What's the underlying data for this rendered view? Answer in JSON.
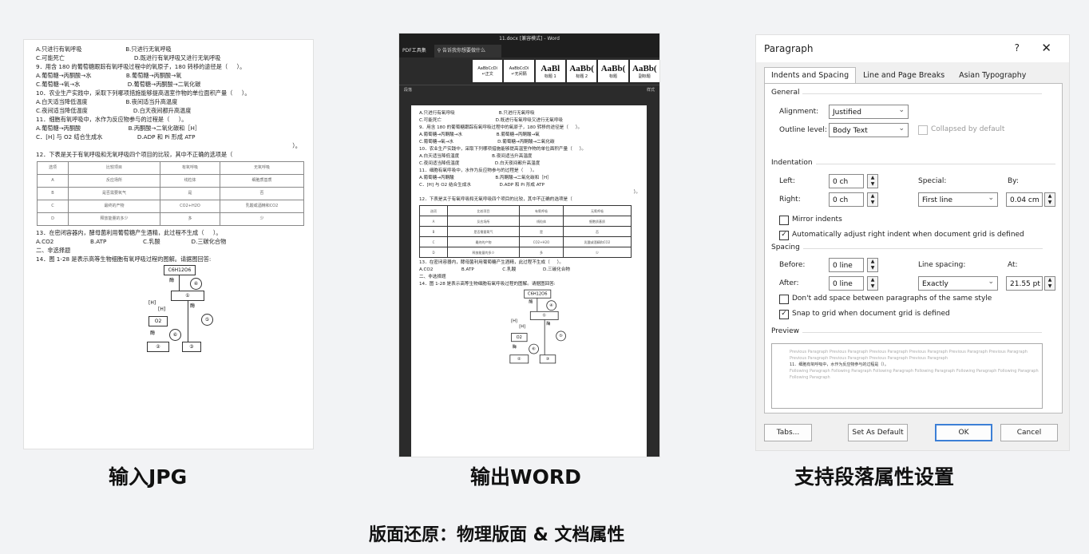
{
  "left_doc": {
    "lines": [
      "A.只进行有氧呼吸                        B.只进行无氧呼吸",
      "C.可能死亡                                      D.既进行有氧呼吸又进行无氧呼吸",
      "9．用含 180 的葡萄糖跟踪有氧呼吸过程中的氧原子，180 转移的途径是（     ）。",
      "A.葡萄糖→丙酮酸→水                   B.葡萄糖→丙酮酸→氧",
      "C.葡萄糖→氧→水                          D.葡萄糖→丙酮酸→二氧化碳",
      "10．农业生产实践中，采取下列哪项措施能够提高温室作物的单位面积产量（     ）。",
      "A.白天适当降低温度                     B.夜间适当升高温度",
      "C.夜间适当降低温度                         D.白天夜间都升高温度",
      "11．细胞有氧呼吸中，水作为反应物参与的过程是（     ）。",
      "A.葡萄糖→丙酮酸                          B.丙酮酸→二氧化碳和［H］",
      "C．[H] 与 O2 结合生成水                   D.ADP 和 Pi 形成 ATP"
    ],
    "trail": "）。",
    "q12": "12．下表是关于有氧呼吸和无氧呼吸四个项目的比较，其中不正确的选项是（",
    "table": [
      [
        "选项",
        "比较项目",
        "有氧呼吸",
        "无氧呼吸"
      ],
      [
        "A",
        "反应场所",
        "线粒体",
        "细胞质基质"
      ],
      [
        "B",
        "是否需要氧气",
        "是",
        "否"
      ],
      [
        "C",
        "最终的产物",
        "CO2+H2O",
        "乳酸或酒精和CO2"
      ],
      [
        "D",
        "释放能量的多少",
        "多",
        "少"
      ]
    ],
    "lines2": [
      "13．在密闭容器内，酵母菌利用葡萄糖产生酒精，此过程不生成（     ）。",
      "A.CO2                    B.ATP                    C.乳酸                 D.三碳化合物",
      "二、非选择题",
      "14．图 1-28 是表示高等生物细胞有氧呼吸过程的图解。请据图回答:"
    ],
    "diagram": {
      "top": "C6H12O6",
      "enzyme": "酶",
      "h1": "[H]",
      "h2": "[H]",
      "o2": "O2",
      "n1": "①",
      "n2": "②",
      "n3": "③",
      "n4": "④",
      "n5": "⑤",
      "n6": "⑥"
    }
  },
  "word": {
    "title": "11.docx [兼容模式] - Word",
    "tab_pdf": "PDF工具集",
    "search": "告诉我你想要做什么",
    "styles": [
      {
        "preview": "AaBbCcDi",
        "name": "↵正文"
      },
      {
        "preview": "AaBbCcDi",
        "name": "↵无间隔"
      },
      {
        "preview": "AaBl",
        "name": "标题 1"
      },
      {
        "preview": "AaBb(",
        "name": "标题 2"
      },
      {
        "preview": "AaBb(",
        "name": "标题"
      },
      {
        "preview": "AaBb(",
        "name": "副标题"
      }
    ],
    "group_para": "段落",
    "group_style": "样式",
    "lines": [
      "A.只进行有氧呼吸                               B.只进行无氧呼吸",
      "C.可能死亡                                      D.既进行有氧呼吸又进行无氧呼吸",
      "9．用含 180 的葡萄糖跟踪有氧呼吸过程中的氧原子，180 转移的途径是（     ）。",
      "A.葡萄糖→丙酮酸→水                        B.葡萄糖→丙酮酸→氧",
      "C.葡萄糖→氧→水                               D.葡萄糖→丙酮酸→二氧化碳",
      "10．农业生产实践中，采取下列哪项措施能够提高温室作物的单位面积产量（     ）。",
      "A.白天适当降低温度                       B.夜间适当升高温度",
      "C.夜间适当降低温度                         D.白天夜间都升高温度",
      "11．细胞有氧呼吸中，水作为反应物参与的过程是（     ）。",
      "A.葡萄糖→丙酮酸                             B.丙酮酸→二氧化碳和［H］",
      "C．[H] 与 O2 结合生成水                    D.ADP 和 Pi 形成 ATP"
    ],
    "trail": "）。",
    "q12": "12．下表是关于有氧呼吸和无氧呼吸四个项目的比较，其中不正确的选项是（",
    "table": [
      [
        "选项",
        "比较项目",
        "有氧呼吸",
        "无氧呼吸"
      ],
      [
        "A",
        "反应场所",
        "线粒体",
        "细胞质基质"
      ],
      [
        "B",
        "是否需要氧气",
        "是",
        "否"
      ],
      [
        "C",
        "最终的产物",
        "CO2+H2O",
        "乳酸或酒精和CO2"
      ],
      [
        "D",
        "释放能量的多少",
        "多",
        "少"
      ]
    ],
    "lines2": [
      "13．在密闭容器内，酵母菌利用葡萄糖产生酒精，此过程不生成（     ）。",
      "A.CO2                    B.ATP                    C.乳酸                   D.三碳化合物",
      "二、非选择题",
      "14．图 1-28 是表示高等生物细胞有氧呼吸过程的图解。请据图回答:"
    ]
  },
  "dialog": {
    "title": "Paragraph",
    "help": "?",
    "close": "✕",
    "tabs": [
      "Indents and Spacing",
      "Line and Page Breaks",
      "Asian Typography"
    ],
    "general": "General",
    "alignment_label": "Alignment:",
    "alignment_value": "Justified",
    "outline_label": "Outline level:",
    "outline_value": "Body Text",
    "collapsed_label": "Collapsed by default",
    "indentation": "Indentation",
    "left_label": "Left:",
    "left_value": "0 ch",
    "right_label": "Right:",
    "right_value": "0 ch",
    "special_label": "Special:",
    "special_value": "First line",
    "by_label": "By:",
    "by_value": "0.04 cm",
    "mirror_label": "Mirror indents",
    "auto_adjust_label": "Automatically adjust right indent when document grid is defined",
    "spacing": "Spacing",
    "before_label": "Before:",
    "before_value": "0 line",
    "after_label": "After:",
    "after_value": "0 line",
    "line_spacing_label": "Line spacing:",
    "line_spacing_value": "Exactly",
    "at_label": "At:",
    "at_value": "21.55 pt",
    "dont_add_label": "Don't add space between paragraphs of the same style",
    "snap_label": "Snap to grid when document grid is defined",
    "preview_label": "Preview",
    "preview_prev": "Previous Paragraph Previous Paragraph Previous Paragraph Previous Paragraph Previous Paragraph Previous Paragraph Previous Paragraph Previous Paragraph Previous Paragraph Previous Paragraph",
    "preview_cur": "11．细胞有氧呼吸中，水作为反应物参与的过程是（）。",
    "preview_next": "Following Paragraph Following Paragraph Following Paragraph Following Paragraph Following Paragraph Following Paragraph Following Paragraph",
    "btn_tabs": "Tabs...",
    "btn_default": "Set As Default",
    "btn_ok": "OK",
    "btn_cancel": "Cancel",
    "edge_left": "n",
    "edge_right": "3"
  },
  "captions": {
    "input": "输入JPG",
    "output": "输出WORD",
    "support": "支持段落属性设置",
    "bottom": "版面还原：物理版面 & 文档属性"
  }
}
